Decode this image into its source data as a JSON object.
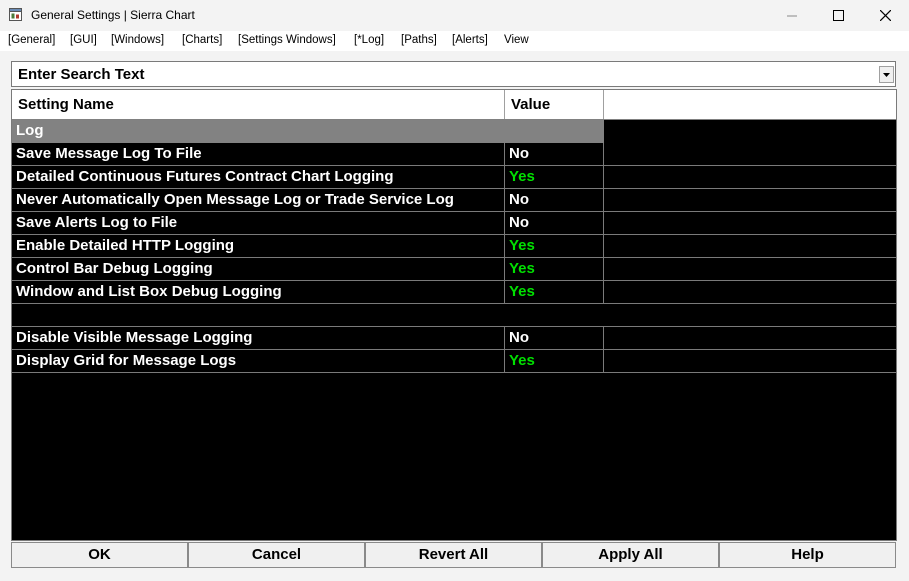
{
  "window": {
    "title": "General Settings | Sierra Chart",
    "icon": "app-icon"
  },
  "menu": [
    "[General]",
    "[GUI]",
    "[Windows]",
    "[Charts]",
    "[Settings Windows]",
    "[*Log]",
    "[Paths]",
    "[Alerts]",
    "View"
  ],
  "search": {
    "placeholder": "Enter Search Text",
    "value": ""
  },
  "grid": {
    "headers": {
      "name": "Setting Name",
      "value": "Value",
      "extra": ""
    },
    "section": "Log",
    "rows_group1": [
      {
        "name": "Save Message Log To File",
        "value": "No"
      },
      {
        "name": "Detailed Continuous Futures Contract Chart Logging",
        "value": "Yes"
      },
      {
        "name": "Never Automatically Open Message Log or Trade Service Log",
        "value": "No"
      },
      {
        "name": "Save Alerts Log to File",
        "value": "No"
      },
      {
        "name": "Enable Detailed HTTP Logging",
        "value": "Yes"
      },
      {
        "name": "Control Bar Debug Logging",
        "value": "Yes"
      },
      {
        "name": "Window and List Box Debug Logging",
        "value": "Yes"
      }
    ],
    "rows_group2": [
      {
        "name": "Disable Visible Message Logging",
        "value": "No"
      },
      {
        "name": "Display Grid for Message Logs",
        "value": "Yes"
      }
    ]
  },
  "buttons": {
    "ok": "OK",
    "cancel": "Cancel",
    "revert_all": "Revert All",
    "apply_all": "Apply All",
    "help": "Help"
  },
  "colors": {
    "yes": "#00e000",
    "no": "#ffffff",
    "section_bg": "#828282",
    "grid_bg": "#000000"
  }
}
